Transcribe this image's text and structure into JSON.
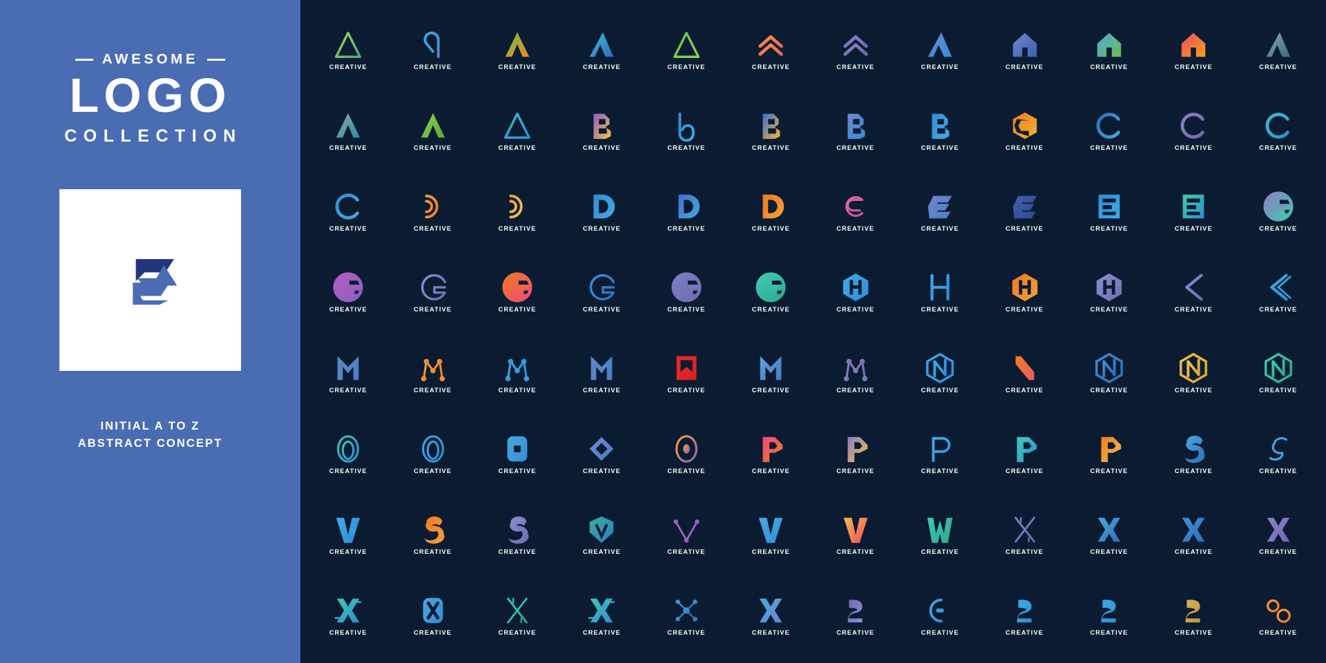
{
  "sidebar": {
    "kicker": "AWESOME",
    "title": "LOGO",
    "subtitle": "COLLECTION",
    "tagline_line1": "INITIAL A TO Z",
    "tagline_line2": "ABSTRACT CONCEPT",
    "background_color": "#4a6cb3",
    "card_background_color": "#ffffff",
    "featured_logo": {
      "name": "hexagonal-e-monogram",
      "color_dark": "#23357a",
      "color_light": "#4a6cb3"
    }
  },
  "grid": {
    "background_color": "#0b1c32",
    "columns": 12,
    "rows": 8,
    "count": 96,
    "word_label": "CREATIVE",
    "logos": [
      {
        "letter": "A",
        "style": "triangle-outline",
        "c1": "#9fd356",
        "c2": "#4cae7a"
      },
      {
        "letter": "A",
        "style": "rounded-loop",
        "c1": "#39a7e8",
        "c2": "#5f87c9"
      },
      {
        "letter": "A",
        "style": "peak-flame",
        "c1": "#6cbf4a",
        "c2": "#f6871f"
      },
      {
        "letter": "A",
        "style": "leaf-blade",
        "c1": "#3fb9e5",
        "c2": "#2f6fb5"
      },
      {
        "letter": "A",
        "style": "stripe-slope",
        "c1": "#6cbf4a",
        "c2": "#8ed24f"
      },
      {
        "letter": "A",
        "style": "double-chevron",
        "c1": "#f79b3e",
        "c2": "#ef5a68"
      },
      {
        "letter": "A",
        "style": "chevron-arch",
        "c1": "#8d7fc4",
        "c2": "#6f6bb0"
      },
      {
        "letter": "A",
        "style": "bold-swoosh",
        "c1": "#6f86d0",
        "c2": "#2f8fd6"
      },
      {
        "letter": "A",
        "style": "pillar-hex",
        "c1": "#6f86d0",
        "c2": "#3f5fa8"
      },
      {
        "letter": "A",
        "style": "dome-arch",
        "c1": "#4aa8e0",
        "c2": "#6cbf4a"
      },
      {
        "letter": "A",
        "style": "house-arrow",
        "c1": "#ef4a5f",
        "c2": "#f6a01f"
      },
      {
        "letter": "A",
        "style": "ribbon-fold",
        "c1": "#9aa7b2",
        "c2": "#2d6b7c"
      },
      {
        "letter": "A",
        "style": "layered-steps",
        "c1": "#8fa3b3",
        "c2": "#2e8ca0"
      },
      {
        "letter": "A",
        "style": "bar-triangle",
        "c1": "#8ed24f",
        "c2": "#5aa83c"
      },
      {
        "letter": "A",
        "style": "thin-peak",
        "c1": "#3fb9c9",
        "c2": "#2f8fd6"
      },
      {
        "letter": "B",
        "style": "fold-block",
        "c1": "#8a5fc0",
        "c2": "#f2c14a"
      },
      {
        "letter": "B",
        "style": "loop-square",
        "c1": "#2f8fd6",
        "c2": "#3fa9e5"
      },
      {
        "letter": "B",
        "style": "curve-fold",
        "c1": "#3f6fd0",
        "c2": "#f2b33a"
      },
      {
        "letter": "B",
        "style": "soft-round",
        "c1": "#6f86d0",
        "c2": "#2f8fd6"
      },
      {
        "letter": "B",
        "style": "arrow-bowl",
        "c1": "#2f8fd6",
        "c2": "#4aa8e0"
      },
      {
        "letter": "C",
        "style": "hex-bite",
        "c1": "#f2791f",
        "c2": "#f2b33a"
      },
      {
        "letter": "C",
        "style": "thick-crescent",
        "c1": "#2f6fb5",
        "c2": "#3fa9e5"
      },
      {
        "letter": "C",
        "style": "thin-circle",
        "c1": "#8d7fc4",
        "c2": "#6f6bb0"
      },
      {
        "letter": "C",
        "style": "gradient-ring",
        "c1": "#3fb9c9",
        "c2": "#2f8fd6"
      },
      {
        "letter": "C",
        "style": "pixel-block",
        "c1": "#2f8fd6",
        "c2": "#4aa8e0"
      },
      {
        "letter": "D",
        "style": "wave-stack",
        "c1": "#f2a03a",
        "c2": "#f2791f"
      },
      {
        "letter": "D",
        "style": "nested-arc",
        "c1": "#f2a03a",
        "c2": "#f2c14a"
      },
      {
        "letter": "D",
        "style": "drop-dot",
        "c1": "#2f8fd6",
        "c2": "#4aa8e0"
      },
      {
        "letter": "D",
        "style": "wire-polygon",
        "c1": "#3f6fd0",
        "c2": "#4aa8e0"
      },
      {
        "letter": "D",
        "style": "ribbon-curl",
        "c1": "#f2791f",
        "c2": "#f2a03a"
      },
      {
        "letter": "E",
        "style": "spiral-round",
        "c1": "#e06aa0",
        "c2": "#c94f90"
      },
      {
        "letter": "E",
        "style": "hex-ribbon",
        "c1": "#6f86d0",
        "c2": "#4a7fc0"
      },
      {
        "letter": "E",
        "style": "solid-hex",
        "c1": "#3f5fa8",
        "c2": "#2f4a90"
      },
      {
        "letter": "E",
        "style": "block-tech",
        "c1": "#2f8fd6",
        "c2": "#3fa9e5"
      },
      {
        "letter": "E",
        "style": "square-maze",
        "c1": "#3fd0a0",
        "c2": "#2f8fd6"
      },
      {
        "letter": "G",
        "style": "gradient-g",
        "c1": "#8d7fc4",
        "c2": "#3fc9b0"
      },
      {
        "letter": "G",
        "style": "speed-dots",
        "c1": "#b05fc0",
        "c2": "#8a5fc0"
      },
      {
        "letter": "G",
        "style": "line-geometric",
        "c1": "#8d8fd4",
        "c2": "#6f6bb0"
      },
      {
        "letter": "G",
        "style": "arrow-swoosh",
        "c1": "#f2791f",
        "c2": "#ef4a7f"
      },
      {
        "letter": "G",
        "style": "target-ring",
        "c1": "#3f8fd6",
        "c2": "#2f6fb5"
      },
      {
        "letter": "G",
        "style": "cut-corner",
        "c1": "#7f7fc4",
        "c2": "#6f6bb0"
      },
      {
        "letter": "G",
        "style": "teal-round",
        "c1": "#3fc9b0",
        "c2": "#2fa890"
      },
      {
        "letter": "H",
        "style": "hex-stroke",
        "c1": "#3fa9e5",
        "c2": "#2f8fd6"
      },
      {
        "letter": "H",
        "style": "outline-tech",
        "c1": "#3fa9e5",
        "c2": "#2f8fd6"
      },
      {
        "letter": "H",
        "style": "orange-solid",
        "c1": "#f2791f",
        "c2": "#f2a03a"
      },
      {
        "letter": "H",
        "style": "hex-link",
        "c1": "#8d8fd4",
        "c2": "#6f6bb0"
      },
      {
        "letter": "K",
        "style": "line-k",
        "c1": "#8d8fd4",
        "c2": "#6f6bb0"
      },
      {
        "letter": "K",
        "style": "stripe-k",
        "c1": "#3fa9e5",
        "c2": "#2f8fd6"
      },
      {
        "letter": "M",
        "style": "flag-block",
        "c1": "#5f87c9",
        "c2": "#4a7fc0"
      },
      {
        "letter": "M",
        "style": "node-network",
        "c1": "#f2a03a",
        "c2": "#f2791f"
      },
      {
        "letter": "M",
        "style": "circuit-lines",
        "c1": "#3fa9e5",
        "c2": "#2f8fd6"
      },
      {
        "letter": "M",
        "style": "solid-angular",
        "c1": "#5f87c9",
        "c2": "#4a7fc0"
      },
      {
        "letter": "M",
        "style": "red-box",
        "c1": "#ef2b2b",
        "c2": "#d41f1f"
      },
      {
        "letter": "M",
        "style": "split-square",
        "c1": "#5f9fd8",
        "c2": "#4a7fc0"
      },
      {
        "letter": "M",
        "style": "molecule",
        "c1": "#8d7fc4",
        "c2": "#6f6bb0"
      },
      {
        "letter": "N",
        "style": "hex-stripe",
        "c1": "#3fa9e5",
        "c2": "#2f8fd6"
      },
      {
        "letter": "N",
        "style": "circle-slash",
        "c1": "#f2791f",
        "c2": "#ef5a68"
      },
      {
        "letter": "N",
        "style": "hex-outline",
        "c1": "#3f8fd6",
        "c2": "#2f6fb5"
      },
      {
        "letter": "N",
        "style": "gold-bars",
        "c1": "#f2c14a",
        "c2": "#e0a832"
      },
      {
        "letter": "N",
        "style": "teal-hex",
        "c1": "#3fc9b0",
        "c2": "#2fa890"
      },
      {
        "letter": "O",
        "style": "nested-oval",
        "c1": "#3fc9b0",
        "c2": "#2f8fd6"
      },
      {
        "letter": "O",
        "style": "swirl-oval",
        "c1": "#3fa9e5",
        "c2": "#2f8fd6"
      },
      {
        "letter": "O",
        "style": "rounded-square",
        "c1": "#4aa8e0",
        "c2": "#2f8fd6"
      },
      {
        "letter": "O",
        "style": "layered-diamond",
        "c1": "#6f86d0",
        "c2": "#4a7fc0"
      },
      {
        "letter": "O",
        "style": "orbit-dot",
        "c1": "#f2a03a",
        "c2": "#8a5fc0"
      },
      {
        "letter": "P",
        "style": "fold-pink",
        "c1": "#ef4a7f",
        "c2": "#f2791f"
      },
      {
        "letter": "P",
        "style": "ribbon-gold",
        "c1": "#8d7fc4",
        "c2": "#f2c14a"
      },
      {
        "letter": "P",
        "style": "thin-blue",
        "c1": "#4aa8e0",
        "c2": "#2f8fd6"
      },
      {
        "letter": "P",
        "style": "facet-gem",
        "c1": "#3fc9b0",
        "c2": "#2f8fd6"
      },
      {
        "letter": "P",
        "style": "stripe-orange",
        "c1": "#f2791f",
        "c2": "#f2c14a"
      },
      {
        "letter": "S",
        "style": "block-s",
        "c1": "#4aa8e0",
        "c2": "#2f6fb5"
      },
      {
        "letter": "S",
        "style": "thin-wave",
        "c1": "#4aa8e0",
        "c2": "#3fa9e5"
      },
      {
        "letter": "V",
        "style": "stripe-slant",
        "c1": "#3fa9e5",
        "c2": "#2f8fd6"
      },
      {
        "letter": "S",
        "style": "orange-swoosh",
        "c1": "#f2791f",
        "c2": "#f2a03a"
      },
      {
        "letter": "S",
        "style": "bar-purple",
        "c1": "#8d8fd4",
        "c2": "#6f6bb0"
      },
      {
        "letter": "V",
        "style": "shield-poly",
        "c1": "#3fc9b0",
        "c2": "#2f8fd6"
      },
      {
        "letter": "V",
        "style": "circuit-v",
        "c1": "#b05fc0",
        "c2": "#8a5fc0"
      },
      {
        "letter": "V",
        "style": "wing-v",
        "c1": "#4aa8e0",
        "c2": "#2f8fd6"
      },
      {
        "letter": "V",
        "style": "cup-v",
        "c1": "#f2c14a",
        "c2": "#ef4a5f"
      },
      {
        "letter": "W",
        "style": "teal-w",
        "c1": "#3fc9b0",
        "c2": "#2fa890"
      },
      {
        "letter": "X",
        "style": "outline-cross",
        "c1": "#8d7fc4",
        "c2": "#6f6bb0"
      },
      {
        "letter": "X",
        "style": "sharp-blade",
        "c1": "#4aa8e0",
        "c2": "#2f6fb5"
      },
      {
        "letter": "X",
        "style": "bold-x",
        "c1": "#3f8fd6",
        "c2": "#2f6fb5"
      },
      {
        "letter": "X",
        "style": "ribbon-x",
        "c1": "#8d7fc4",
        "c2": "#6f6bb0"
      },
      {
        "letter": "X",
        "style": "speed-x",
        "c1": "#3fc9b0",
        "c2": "#2f8fd6"
      },
      {
        "letter": "X",
        "style": "rounded-box-x",
        "c1": "#4aa8e0",
        "c2": "#2f8fd6"
      },
      {
        "letter": "X",
        "style": "line-maze-x",
        "c1": "#3fc9b0",
        "c2": "#2fa890"
      },
      {
        "letter": "X",
        "style": "stripe-x",
        "c1": "#3fc9b0",
        "c2": "#2f8fd6"
      },
      {
        "letter": "X",
        "style": "dot-network-x",
        "c1": "#3fa9e5",
        "c2": "#2f6fb5"
      },
      {
        "letter": "X",
        "style": "glitch-x",
        "c1": "#4aa8e0",
        "c2": "#6f86d0"
      },
      {
        "letter": "Z",
        "style": "stripe-blob",
        "c1": "#6f6bb0",
        "c2": "#8d8fd4"
      },
      {
        "letter": "Z",
        "style": "chain-link",
        "c1": "#3fa9e5",
        "c2": "#2f8fd6"
      },
      {
        "letter": "Z",
        "style": "pixel-z",
        "c1": "#3fa9e5",
        "c2": "#2f8fd6"
      },
      {
        "letter": "Z",
        "style": "round-z",
        "c1": "#3fa9e5",
        "c2": "#2f8fd6"
      },
      {
        "letter": "Z",
        "style": "gold-z",
        "c1": "#d4b05a",
        "c2": "#c09a42"
      },
      {
        "letter": "Z",
        "style": "infinity-loops",
        "c1": "#f2a03a",
        "c2": "#f2791f"
      }
    ]
  }
}
